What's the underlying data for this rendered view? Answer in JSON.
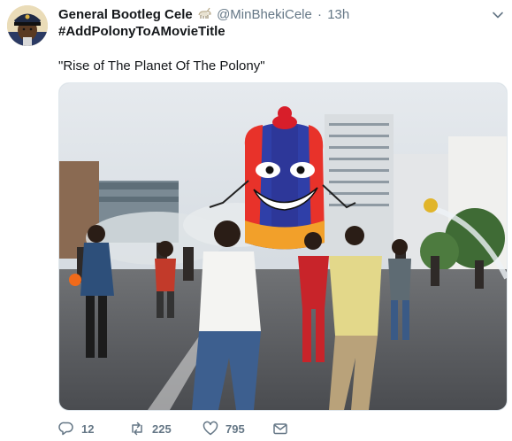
{
  "tweet": {
    "author_name": "General Bootleg Cele",
    "author_handle": "@MinBhekiCele",
    "separator": "·",
    "timestamp": "13h",
    "hashtag": "#AddPolonyToAMovieTitle",
    "text": "\"Rise of The Planet Of The Polony\"",
    "icons": {
      "avatar": "police-officer-avatar",
      "verified_badge": "goat-emoji-icon",
      "menu": "chevron-down-icon",
      "reply": "reply-icon",
      "retweet": "retweet-icon",
      "like": "heart-icon",
      "message": "envelope-icon"
    },
    "stats": {
      "replies": "12",
      "retweets": "225",
      "likes": "795"
    }
  },
  "colors": {
    "text_primary": "#14171a",
    "text_secondary": "#657786",
    "border": "#e1e8ed"
  }
}
